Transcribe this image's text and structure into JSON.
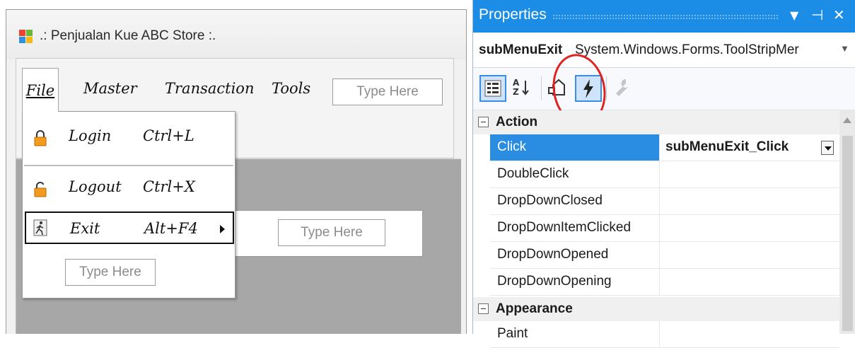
{
  "designer": {
    "window_title": ".: Penjualan Kue ABC Store :.",
    "menu": {
      "file": "File",
      "master": "Master",
      "transaction": "Transaction",
      "tools": "Tools",
      "type_here": "Type Here"
    },
    "file_menu_items": [
      {
        "label": "Login",
        "shortcut": "Ctrl+L",
        "icon": "lock-icon"
      },
      {
        "label": "Logout",
        "shortcut": "Ctrl+X",
        "icon": "lock-icon"
      },
      {
        "label": "Exit",
        "shortcut": "Alt+F4",
        "icon": "running-man-icon"
      }
    ],
    "dropdown_type_here": "Type Here",
    "submenu_type_here": "Type Here"
  },
  "properties": {
    "title": "Properties",
    "object_name": "subMenuExit",
    "object_type": "System.Windows.Forms.ToolStripMer",
    "categories": [
      {
        "label": "Action",
        "rows": [
          {
            "name": "Click",
            "value": "subMenuExit_Click"
          },
          {
            "name": "DoubleClick",
            "value": ""
          },
          {
            "name": "DropDownClosed",
            "value": ""
          },
          {
            "name": "DropDownItemClicked",
            "value": ""
          },
          {
            "name": "DropDownOpened",
            "value": ""
          },
          {
            "name": "DropDownOpening",
            "value": ""
          }
        ]
      },
      {
        "label": "Appearance",
        "rows": [
          {
            "name": "Paint",
            "value": ""
          }
        ]
      }
    ]
  },
  "colors": {
    "header_blue": "#1c8de6",
    "selection_blue": "#2b8de2",
    "annotation_red": "#e02222"
  }
}
